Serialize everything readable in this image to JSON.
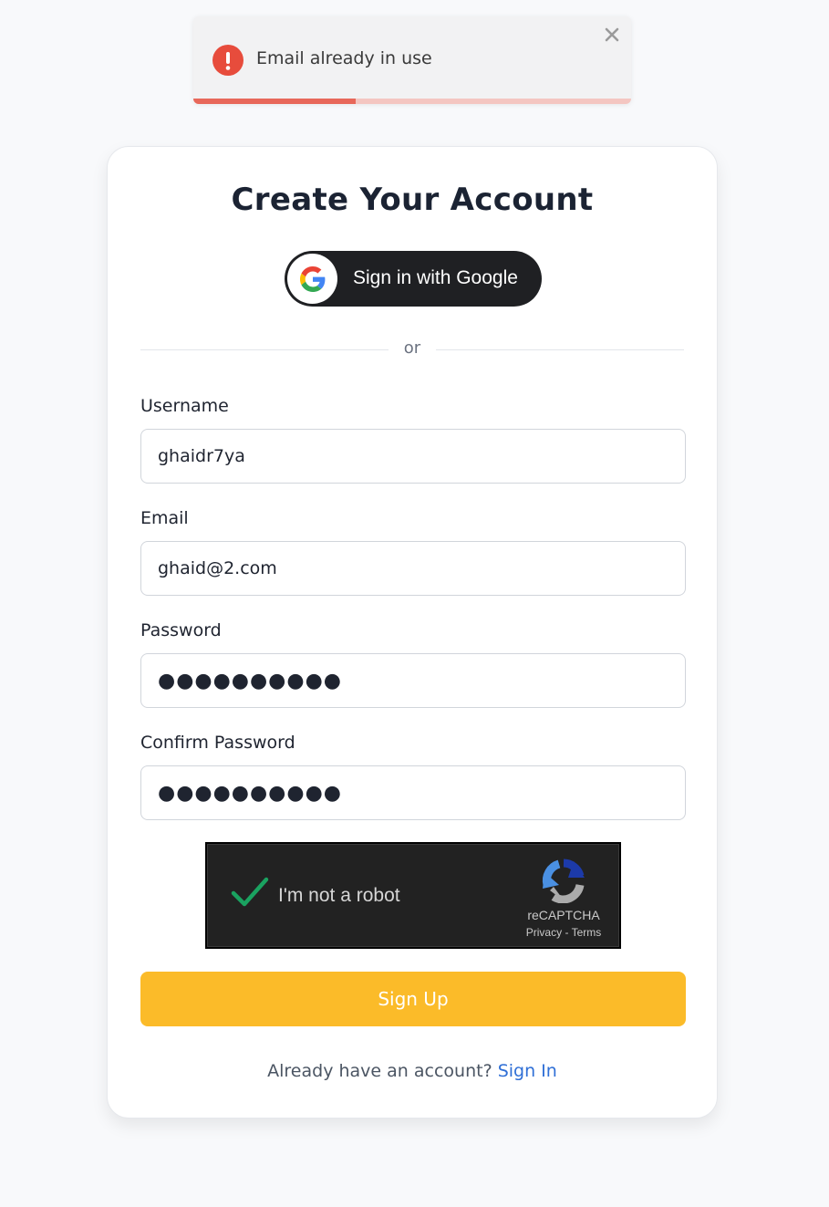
{
  "toast": {
    "message": "Email already in use",
    "icon": "error-icon",
    "close_icon": "close-icon",
    "progress": 0.37,
    "colors": {
      "error": "#e74c3c",
      "progress": "#e8685a",
      "track": "#f4c6c1"
    }
  },
  "form": {
    "title": "Create Your Account",
    "google_button_label": "Sign in with Google",
    "divider_text": "or",
    "fields": {
      "username": {
        "label": "Username",
        "value": "ghaidr7ya"
      },
      "email": {
        "label": "Email",
        "value": "ghaid@2.com"
      },
      "password": {
        "label": "Password",
        "value": "●●●●●●●●●●"
      },
      "confirm_password": {
        "label": "Confirm Password",
        "value": "●●●●●●●●●●"
      }
    },
    "recaptcha": {
      "label": "I'm not a robot",
      "checked": true,
      "brand": "reCAPTCHA",
      "privacy": "Privacy",
      "separator": " - ",
      "terms": "Terms"
    },
    "submit_label": "Sign Up",
    "footer": {
      "prompt": "Already have an account?",
      "link": "Sign In"
    },
    "colors": {
      "accent": "#fbbb29",
      "link": "#2f6fd6"
    }
  }
}
